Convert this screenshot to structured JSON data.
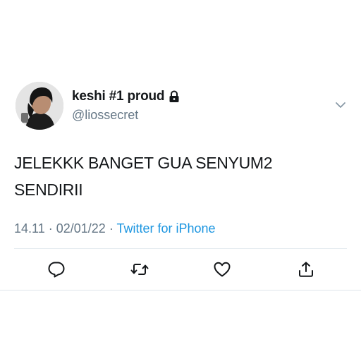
{
  "tweet": {
    "display_name": "keshi #1 proud",
    "handle": "@liossecret",
    "text_line1": "JELEKKK BANGET GUA SENYUM2",
    "text_line2": "SENDIRII",
    "time": "14.11",
    "date": "02/01/22",
    "separator": "·",
    "source": "Twitter for iPhone"
  },
  "icons": {
    "lock": "lock-icon",
    "menu": "chevron-down-icon",
    "reply": "reply-icon",
    "retweet": "retweet-icon",
    "like": "heart-icon",
    "share": "share-icon"
  },
  "colors": {
    "text": "#14171a",
    "secondary": "#657786",
    "link": "#1b95e0",
    "divider": "#e6ecf0"
  }
}
